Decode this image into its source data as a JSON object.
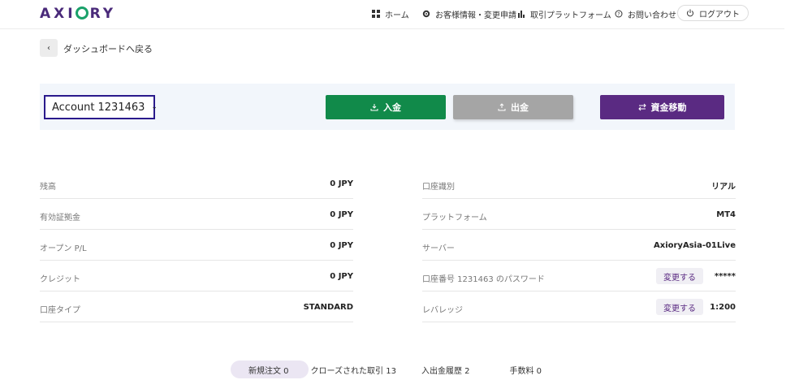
{
  "header": {
    "logo": "AXIORY",
    "nav": {
      "home": "ホーム",
      "customer_info": "お客様情報・変更申請",
      "platform": "取引プラットフォーム",
      "contact": "お問い合わせ",
      "logout": "ログアウト"
    }
  },
  "back": {
    "label": "ダッシュボードへ戻る"
  },
  "account": {
    "prefix": "Account",
    "number": "1231463"
  },
  "actions": {
    "deposit": "入金",
    "withdraw": "出金",
    "transfer": "資金移動"
  },
  "details_left": [
    {
      "label": "残高",
      "value": "0 JPY"
    },
    {
      "label": "有効証拠金",
      "value": "0 JPY"
    },
    {
      "label": "オープン P/L",
      "value": "0 JPY"
    },
    {
      "label": "クレジット",
      "value": "0 JPY"
    },
    {
      "label": "口座タイプ",
      "value": "STANDARD"
    }
  ],
  "details_right": [
    {
      "label": "口座識別",
      "value": "リアル"
    },
    {
      "label": "プラットフォーム",
      "value": "MT4"
    },
    {
      "label": "サーバー",
      "value": "AxioryAsia-01Live"
    },
    {
      "label": "口座番号 1231463 のパスワード",
      "value": "*****",
      "action": "変更する"
    },
    {
      "label": "レバレッジ",
      "value": "1:200",
      "action": "変更する"
    }
  ],
  "tabs": [
    {
      "label": "新規注文 0"
    },
    {
      "label": "クローズされた取引 13"
    },
    {
      "label": "入出金履歴 2"
    },
    {
      "label": "手数料 0"
    }
  ]
}
